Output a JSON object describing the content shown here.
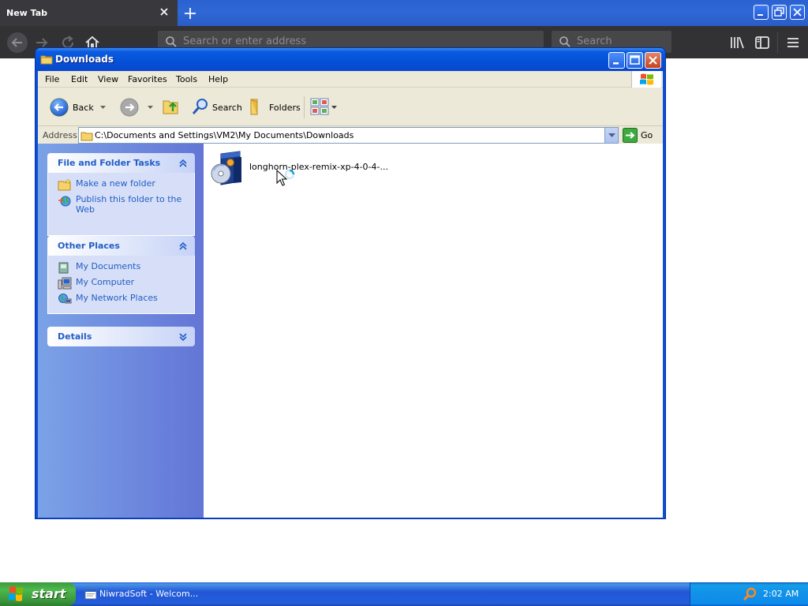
{
  "browser": {
    "tab_title": "New Tab",
    "url_placeholder": "Search or enter address",
    "search_placeholder": "Search"
  },
  "explorer": {
    "title": "Downloads",
    "menu": [
      "File",
      "Edit",
      "View",
      "Favorites",
      "Tools",
      "Help"
    ],
    "toolbar": {
      "back": "Back",
      "search": "Search",
      "folders": "Folders"
    },
    "address": {
      "label": "Address",
      "path": "C:\\Documents and Settings\\VM2\\My Documents\\Downloads",
      "go": "Go"
    },
    "tasks": {
      "title": "File and Folder Tasks",
      "items": [
        "Make a new folder",
        "Publish this folder to the Web"
      ]
    },
    "other_places": {
      "title": "Other Places",
      "items": [
        "My Documents",
        "My Computer",
        "My Network Places"
      ]
    },
    "details": {
      "title": "Details"
    },
    "files": [
      {
        "name": "longhorn-plex-remix-xp-4-0-4-..."
      }
    ]
  },
  "taskbar": {
    "start": "start",
    "items": [
      "NiwradSoft - Welcom..."
    ],
    "clock": "2:02 AM"
  },
  "colors": {
    "xp_blue": "#0a4fd8",
    "taskpane_link": "#215dc6",
    "start_green": "#3c9a3c",
    "firefox_dark": "#323234"
  }
}
